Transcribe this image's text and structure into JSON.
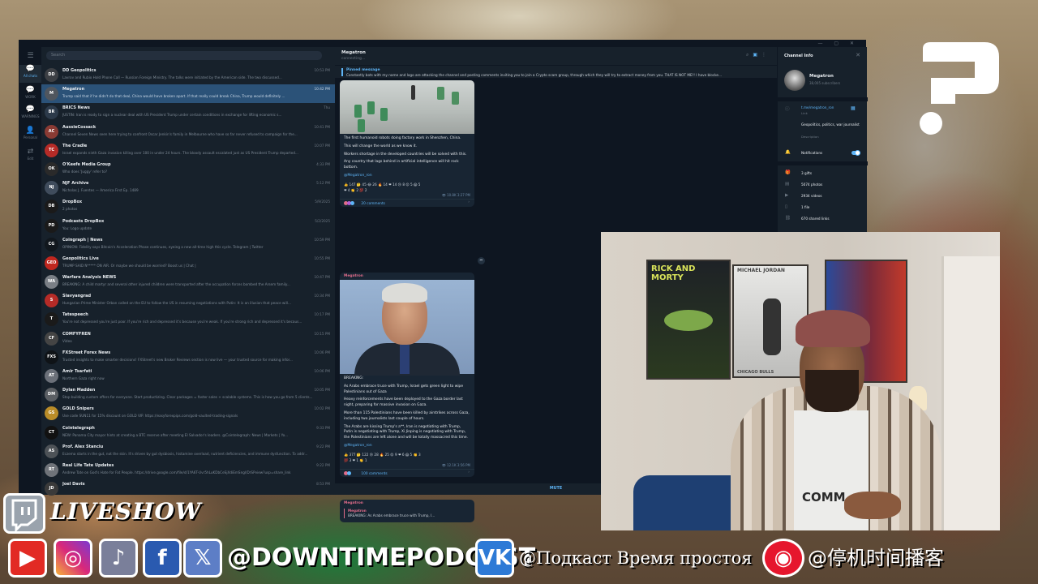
{
  "chat_list": {
    "search_placeholder": "Search",
    "rows": [
      {
        "name": "DD Geopolitics",
        "preview": "Lavrov and Rubio Hold Phone Call — Russian Foreign Ministry. The talks were initiated by the American side. The two discussed...",
        "time": "10:53 PM",
        "badge": "",
        "avatar": "DD",
        "color": "#3c3f44",
        "active": false
      },
      {
        "name": "Megatron",
        "preview": "Trump said that if he didn't do that deal, China would have broken apart. If that really could break China, Trump would definitely ...",
        "time": "10:42 PM",
        "badge": "",
        "avatar": "M",
        "color": "#50565e",
        "active": true
      },
      {
        "name": "BRICS News",
        "preview": "JUSTIN: Iran is ready to sign a nuclear deal with US President Trump under certain conditions in exchange for lifting economic s...",
        "time": "Thu",
        "badge": "",
        "avatar": "BR",
        "color": "#2c3a4a",
        "active": false
      },
      {
        "name": "AussieCossack",
        "preview": "Channel Seven News seen here trying to confront Oscar Jenkin's family in Melbourne who have so far never refused to campaign for the...",
        "time": "10:41 PM",
        "badge": "",
        "avatar": "AC",
        "color": "#8a3b34",
        "active": false
      },
      {
        "name": "The Cradle",
        "preview": "Israel expands ninth Gaza invasion killing over 100 in under 24 hours. The bloody assault escalated just as US President Trump departed...",
        "time": "10:07 PM",
        "badge": "",
        "avatar": "TC",
        "color": "#b52b27",
        "active": false
      },
      {
        "name": "O'Keefe Media Group",
        "preview": "Who does 'Juggy' refer to?",
        "time": "4:33 PM",
        "badge": "",
        "avatar": "OK",
        "color": "#2a2a2a",
        "active": false
      },
      {
        "name": "NJF Archive",
        "preview": "Nicholas J. Fuentes — America First Ep. 1489",
        "time": "5:12 PM",
        "badge": "",
        "avatar": "NJ",
        "color": "#3f4c5c",
        "active": false
      },
      {
        "name": "DropBox",
        "preview": "2 photos",
        "time": "5/9/2025",
        "badge": "",
        "avatar": "DB",
        "color": "#1a1a1a",
        "active": false
      },
      {
        "name": "Podcasts DropBox",
        "preview": "You: Logo update",
        "time": "5/2/2025",
        "badge": "",
        "avatar": "PD",
        "color": "#1a1a1a",
        "active": false
      },
      {
        "name": "Coingraph | News",
        "preview": "OPINION: Fidelity says Bitcoin's Acceleration Phase continues, eyeing a new all-time high this cycle. Telegram | Twitter",
        "time": "10:59 PM",
        "badge": "",
        "avatar": "CG",
        "color": "#11171d",
        "active": false
      },
      {
        "name": "Geopolitics Live",
        "preview": "TRUMP SAID N***** ON AIR. Or maybe we should be worried? Boost us | Chat |",
        "time": "10:55 PM",
        "badge": "",
        "avatar": "GEO",
        "color": "#c0271f",
        "active": false
      },
      {
        "name": "Warfare Analysis NEWS",
        "preview": "BREAKING: A child martyr and several other injured children were transported after the occupation forces bombed the Arsem family...",
        "time": "10:47 PM",
        "badge": "",
        "avatar": "WA",
        "color": "#7a7f86",
        "active": false
      },
      {
        "name": "Slavyangrad",
        "preview": "Hungarian Prime Minister Orban called on the EU to follow the US in resuming negotiations with Putin: It is an illusion that peace will...",
        "time": "10:34 PM",
        "badge": "",
        "avatar": "S",
        "color": "#b52b27",
        "active": false
      },
      {
        "name": "Tatespeech",
        "preview": "You're not depressed you're just poor. If you're rich and depressed it's because you're weak. If you're strong rich and depressed it's becaus...",
        "time": "10:17 PM",
        "badge": "",
        "avatar": "T",
        "color": "#1a1a1a",
        "active": false
      },
      {
        "name": "COMFYFREN",
        "preview": "Video",
        "time": "10:15 PM",
        "badge": "",
        "avatar": "CF",
        "color": "#444",
        "active": false
      },
      {
        "name": "FXStreet Forex News",
        "preview": "Trusted insights to make smarter decisions! FXStreet's new Broker Reviews section is now live — your trusted source for making infor...",
        "time": "10:06 PM",
        "badge": "",
        "avatar": "FXS",
        "color": "#0f1317",
        "active": false
      },
      {
        "name": "Amir Tsarfati",
        "preview": "Northern Gaza right now",
        "time": "10:06 PM",
        "badge": "",
        "avatar": "AT",
        "color": "#6b7079",
        "active": false
      },
      {
        "name": "Dylan Madden",
        "preview": "Stop building custom offers for everyone. Start productizing. Clear packages = faster sales + scalable systems. This is how you go from 5 clients...",
        "time": "10:05 PM",
        "badge": "",
        "avatar": "DM",
        "color": "#5b5f64",
        "active": false
      },
      {
        "name": "GOLD Snipers",
        "preview": "Use code SUN11 for 15% discount on GOLD VIP. https://easyforexpips.com/gold-vaulted-trading-signals",
        "time": "10:02 PM",
        "badge": "",
        "avatar": "GS",
        "color": "#b98c28",
        "active": false
      },
      {
        "name": "Cointelegraph",
        "preview": "NEW: Panama City mayor hints at creating a BTC reserve after meeting El Salvador's leaders. @Cointelegraph: News | Markets | Yo...",
        "time": "9:33 PM",
        "badge": "",
        "avatar": "CT",
        "color": "#111",
        "active": false
      },
      {
        "name": "Prof. Alex Stanciu",
        "preview": "Eczema starts in the gut, not the skin. It's driven by gut dysbiosis, histamine overload, nutrient deficiencies, and immune dysfunction. To addr...",
        "time": "9:22 PM",
        "badge": "",
        "avatar": "AS",
        "color": "#4d5257",
        "active": false
      },
      {
        "name": "Real Life Tate Updates",
        "preview": "Andrew Tate on God's Hate for Fat People. https://drive.google.com/file/d/1YA6T-Uvr5hLuKDbCeSjXdiEmSngl/DrSPview?usp=share_link",
        "time": "9:22 PM",
        "badge": "",
        "avatar": "RT",
        "color": "#6f7379",
        "active": false
      },
      {
        "name": "Joel Davis",
        "preview": "",
        "time": "8:53 PM",
        "badge": "",
        "avatar": "JD",
        "color": "#3a3a3a",
        "active": false
      }
    ]
  },
  "rail": [
    {
      "icon": "chat-bubble",
      "label": "All chats",
      "active": true
    },
    {
      "icon": "chat-bubble",
      "label": "WORK",
      "active": false
    },
    {
      "icon": "chat-bubble",
      "label": "WARNINGS",
      "active": false
    },
    {
      "icon": "person",
      "label": "Personal",
      "active": false
    },
    {
      "icon": "edit",
      "label": "Edit",
      "active": false
    }
  ],
  "chat": {
    "title": "Megatron",
    "status": "connecting...",
    "pinned_title": "Pinned message",
    "pinned_text": "Constantly bots with my name and logo are attacking the channel and posting comments inviting you to join a Crypto scam group, through which they will try to extract money from you. THAT IS NOT ME!! I have blocke...",
    "msg1": {
      "p1": "The first humanoid robots doing factory work in Shenzhen, China.",
      "p2": "This will change the world as we know it.",
      "p3": "Workers shortage in the developed countries will be solved with this.",
      "p4": "Any country that lags behind in artificial intelligence will hit rock bottom.",
      "link": "@Megatron_ron",
      "reactions1": "👍 147  🤔 45  😂 26  🔥 14  ❤ 14  😢 8  😡 5  😱 5",
      "reactions2": "❤ 4  👏 2  💯 2",
      "meta": "👁 10.8K  3:27 PM",
      "comments": "20 comments"
    },
    "msg2": {
      "p1": "BREAKING:",
      "p2": "As Arabs embrace truce with Trump, Israel gets green light to wipe Palestinians out of Gaza",
      "p3": "Heavy reinforcements have been deployed to the Gaza border last night, preparing for massive invasion on Gaza.",
      "p4": "More than 115 Palestinians have been killed by airstrikes across Gaza, including two journalists last couple of hours.",
      "p5": "The Arabs are kissing Trump's a**, Iran is negotiating with Trump, Putin is negotiating with Trump, Xi Jinping is negotiating with Trump, the Palestinians are left alone and will be totally massacred this time.",
      "link": "@Megatron_ron",
      "reactions1": "👍 377  🤔 122  😢 28  🔥 25  😡 9  ❤ 6  😱 5  👏 3",
      "reactions2": "💯 3  ❤ 1  👏 1",
      "meta": "👁 12.1K  3:56 PM",
      "comments": "100 comments"
    },
    "msg3": {
      "author": "Megatron",
      "quote": "BREAKING: As Arabs embrace truce with Trump, I..."
    },
    "mute": "MUTE"
  },
  "channel_info": {
    "title": "Channel Info",
    "name": "Megatron",
    "subscribers": "38,005 subscribers",
    "link": "t.me/megatron_ron",
    "link_label": "Link",
    "description": "Geopolitics, politics, war journalist",
    "description_label": "Description",
    "notifications": "Notifications",
    "gifts": "3 gifts",
    "photos": "5074 photos",
    "videos": "2934 videos",
    "files": "1 file",
    "links": "670 shared links"
  },
  "overlay": {
    "liveshow": "LIVESHOW",
    "handle_main": "@DOWNTIMEPODCAST",
    "handle_vk": "@Подкаст Время простоя",
    "handle_weibo": "@停机时间播客",
    "posters": [
      "RICK AND MORTY",
      "MICHAEL JORDAN",
      "CHICAGO BULLS"
    ],
    "shirt_text": "COMM"
  },
  "colors": {
    "telegram_bg": "#17212b",
    "telegram_accent": "#5eb5f7",
    "active_row": "#2b5278"
  }
}
